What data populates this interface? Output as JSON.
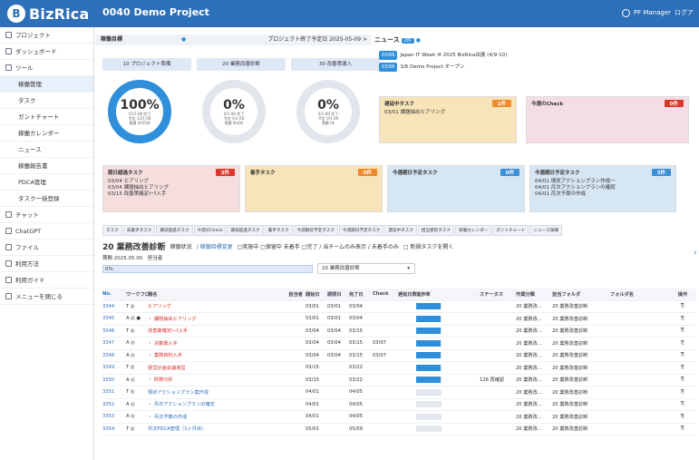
{
  "app": {
    "name": "BizRica",
    "project": "0040 Demo Project",
    "user": "PF Manager",
    "logout": "ログア"
  },
  "sidebar": {
    "items": [
      {
        "label": "プロジェクト",
        "sub": false
      },
      {
        "label": "ダッシュボード",
        "sub": false
      },
      {
        "label": "ツール",
        "sub": false
      },
      {
        "label": "稼働管理",
        "sub": true,
        "selected": true
      },
      {
        "label": "タスク",
        "sub": true
      },
      {
        "label": "ガントチャート",
        "sub": true
      },
      {
        "label": "稼働カレンダー",
        "sub": true
      },
      {
        "label": "ニュース",
        "sub": true
      },
      {
        "label": "稼働報告書",
        "sub": true
      },
      {
        "label": "PDCA管理",
        "sub": true
      },
      {
        "label": "タスク一括登録",
        "sub": true
      },
      {
        "label": "チャット",
        "sub": false
      },
      {
        "label": "ChatGPT",
        "sub": false
      },
      {
        "label": "ファイル",
        "sub": false
      },
      {
        "label": "利用方法",
        "sub": false
      },
      {
        "label": "利用ガイド",
        "sub": false
      },
      {
        "label": "メニューを閉じる",
        "sub": false
      }
    ]
  },
  "header": {
    "section": "稼働目標",
    "deadline": "プロジェクト終了予定日 2025-05-09 >",
    "news_title": "ニュース",
    "news_count": "2件"
  },
  "kpis": [
    {
      "label": "10 プロジェクト準備"
    },
    {
      "label": "20 業務改善診断"
    },
    {
      "label": "30 改善策導入"
    }
  ],
  "rings": [
    {
      "pct": "100%",
      "lines": [
        "15/1-08 完了",
        "予定 13/1-08",
        "実績 2025/8"
      ],
      "full": true
    },
    {
      "pct": "0%",
      "lines": [
        "0/1-08 完了",
        "予定 0/1-08",
        "実績 0h/0h"
      ],
      "full": false
    },
    {
      "pct": "0%",
      "lines": [
        "0/1-09 完了",
        "予定 0/1-09",
        "実績 0h"
      ],
      "full": false
    }
  ],
  "news": [
    {
      "date": "03/06",
      "text": "Japan IT Week ⑩ 2025 BizRica出展 (4/9-10)"
    },
    {
      "date": "03/06",
      "text": "3/6 Demo Project オープン"
    }
  ],
  "cards": [
    {
      "title": "遅延中タスク",
      "badge": "1件",
      "bg": "#f7e4b8",
      "rows": [
        "03/01  課題抽出ヒアリング"
      ]
    },
    {
      "title": "今週のCheck",
      "badge": "0件",
      "bg": "#f4dde4",
      "rows": []
    },
    {
      "title": "期日超過タスク",
      "badge": "3件",
      "bg": "#f6dede",
      "rows": [
        "03/04 ヒアリング",
        "03/04  課題抽出ヒアリング",
        "03/15 改善策確定ﾄｰｸ入手"
      ]
    },
    {
      "title": "着手タスク",
      "badge": "0件",
      "bg": "#f7e4b8",
      "rows": []
    },
    {
      "title": "今週期日予定タスク",
      "badge": "0件",
      "bg": "#d6e6f3",
      "rows": []
    },
    {
      "title": "今週期日予定タスク",
      "badge": "3件",
      "bg": "#d6e6f3",
      "rows": [
        "04/01 現状アクションプラン作成一",
        "04/01 月次アクションプランの確認",
        "04/01 月次予算の作成"
      ]
    }
  ],
  "tabs": [
    "タスク",
    "未着手タスク",
    "期日超過タスク",
    "今週のCheck",
    "期日超過タスク",
    "着手タスク",
    "今週期日予定タスク",
    "今週期日予定タスク",
    "遅延中タスク",
    "担当者別タスク",
    "稼働カレンダー",
    "ガントチャート",
    "ニュース詳細"
  ],
  "filter": {
    "title": "20 業務改善診断",
    "status": "稼働状況",
    "link": "/ 稼働目標変更",
    "options": "□実施中 □保留中 未着手 □完了 / 当チームのみ表示 / 未着手のみ",
    "newtask": "□ 新規タスクを開く",
    "period": "期間 2025.05.00　担当者"
  },
  "progress": {
    "label": "0%"
  },
  "select": {
    "value": "20 業務改善診断"
  },
  "table": {
    "headers": [
      "No.",
      "ワークフロー",
      "題名",
      "担当者",
      "開始日",
      "期限日",
      "完了日",
      "Check",
      "遅延日数",
      "進捗率",
      "ステータス",
      "作業分類",
      "担当フォルダ",
      "フォルダ名",
      "操作"
    ],
    "rows": [
      {
        "no": "3344",
        "wf": "T ◎",
        "title": "ヒアリング",
        "red": true,
        "start": "03/01",
        "due": "03/01",
        "done": "03/04",
        "check": "",
        "delay": "",
        "prog": 0.95,
        "status": "",
        "cat": "20 業務改…",
        "folder": "20 業務改善診断"
      },
      {
        "no": "3345",
        "wf": "A ◎ ●",
        "title": "・ 課題抽出ヒアリング",
        "red": true,
        "start": "03/01",
        "due": "03/01",
        "done": "03/04",
        "check": "",
        "delay": "",
        "prog": 0.95,
        "status": "",
        "cat": "20 業務改…",
        "folder": "20 業務改善診断"
      },
      {
        "no": "3346",
        "wf": "T ◎",
        "title": "改善策確定ﾄｰｸ入手",
        "red": true,
        "start": "03/04",
        "due": "03/04",
        "done": "03/15",
        "check": "",
        "delay": "",
        "prog": 0.95,
        "status": "",
        "cat": "20 業務改…",
        "folder": "20 業務改善診断"
      },
      {
        "no": "3347",
        "wf": "A ◎",
        "title": "・ 決算書入手",
        "red": true,
        "start": "03/04",
        "due": "03/04",
        "done": "03/15",
        "check": "03/07",
        "delay": "",
        "prog": 0.95,
        "status": "",
        "cat": "20 業務改…",
        "folder": "20 業務改善診断"
      },
      {
        "no": "3348",
        "wf": "A ◎",
        "title": "・ 業務資料入手",
        "red": true,
        "start": "03/04",
        "due": "03/04",
        "done": "03/15",
        "check": "03/07",
        "delay": "",
        "prog": 0.95,
        "status": "",
        "cat": "20 業務改…",
        "folder": "20 業務改善診断"
      },
      {
        "no": "3349",
        "wf": "T ◎",
        "title": "経営計画会議運営",
        "red": true,
        "start": "03/15",
        "due": "",
        "done": "03/22",
        "check": "",
        "delay": "",
        "prog": 0.95,
        "status": "",
        "cat": "20 業務改…",
        "folder": "20 業務改善診断"
      },
      {
        "no": "3350",
        "wf": "A ◎",
        "title": "・ 財務分析",
        "red": true,
        "start": "03/15",
        "due": "",
        "done": "03/22",
        "check": "",
        "delay": "",
        "prog": 0.95,
        "status": "126 再確認",
        "cat": "20 業務改…",
        "folder": "20 業務改善診断"
      },
      {
        "no": "3351",
        "wf": "T ◎",
        "title": "現状アクションプラン案作成",
        "red": false,
        "start": "04/01",
        "due": "",
        "done": "04/05",
        "check": "",
        "delay": "",
        "prog": 0,
        "status": "",
        "cat": "20 業務改…",
        "folder": "20 業務改善診断"
      },
      {
        "no": "3352",
        "wf": "A ◎",
        "title": "・ 月次アクションプランの確定",
        "red": false,
        "start": "04/01",
        "due": "",
        "done": "04/05",
        "check": "",
        "delay": "",
        "prog": 0,
        "status": "",
        "cat": "20 業務改…",
        "folder": "20 業務改善診断"
      },
      {
        "no": "3353",
        "wf": "A ◎",
        "title": "・ 月次予算の作成",
        "red": false,
        "start": "04/01",
        "due": "",
        "done": "04/05",
        "check": "",
        "delay": "",
        "prog": 0,
        "status": "",
        "cat": "20 業務改…",
        "folder": "20 業務改善診断"
      },
      {
        "no": "3354",
        "wf": "T ◎",
        "title": "月次PDCA管理（1ヶ月目）",
        "red": false,
        "start": "05/01",
        "due": "",
        "done": "05/09",
        "check": "",
        "delay": "",
        "prog": 0,
        "status": "",
        "cat": "20 業務改…",
        "folder": "20 業務改善診断"
      }
    ]
  }
}
